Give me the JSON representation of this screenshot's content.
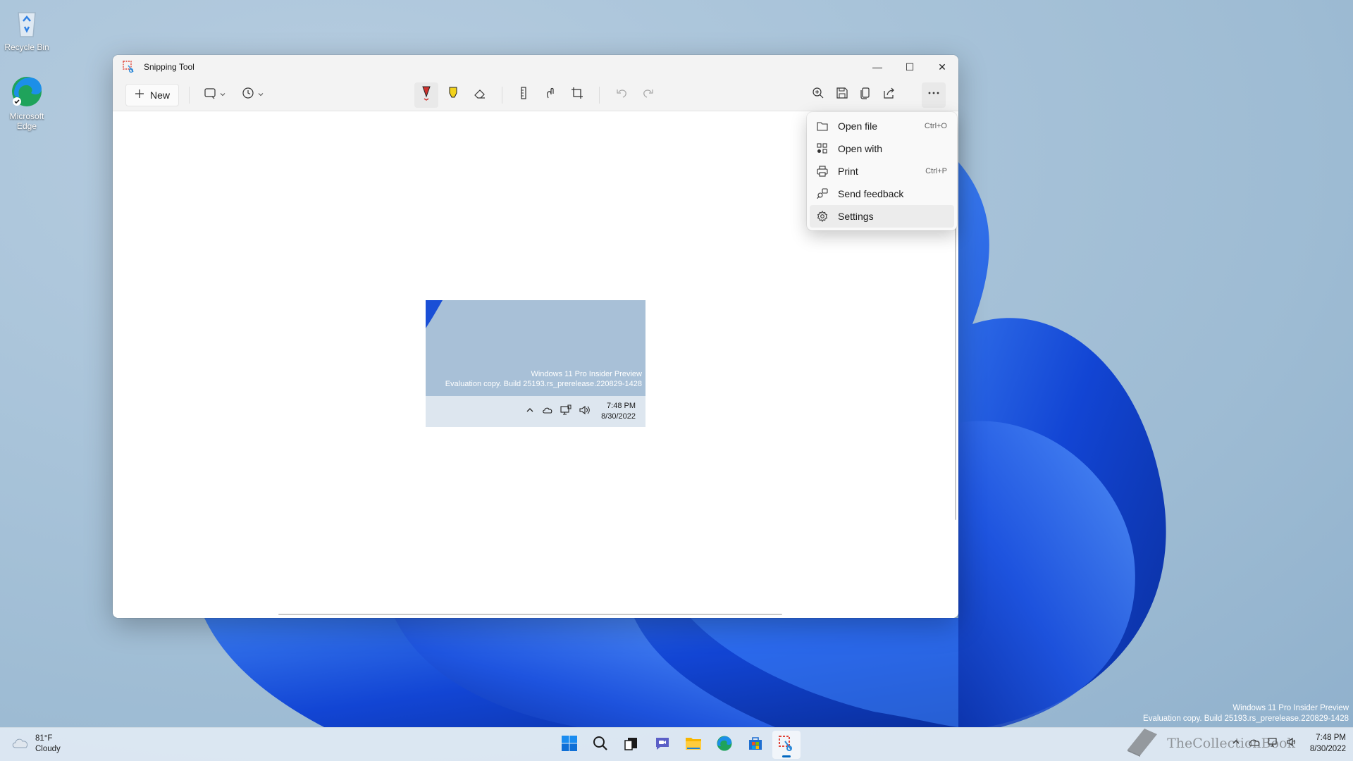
{
  "desktop": {
    "icons": [
      {
        "label": "Recycle Bin"
      },
      {
        "label": "Microsoft Edge"
      }
    ],
    "watermark": {
      "line1": "Windows 11 Pro Insider Preview",
      "line2": "Evaluation copy. Build 25193.rs_prerelease.220829-1428"
    },
    "site_watermark": "TheCollectionBook"
  },
  "window": {
    "title": "Snipping Tool",
    "caption_buttons": {
      "minimize": "—",
      "maximize": "☐",
      "close": "✕"
    },
    "toolbar": {
      "new_label": "New",
      "tools": [
        "snip-mode",
        "delay",
        "ballpoint-pen",
        "highlighter",
        "eraser",
        "ruler",
        "touch-writing",
        "crop",
        "undo",
        "redo",
        "zoom",
        "save",
        "copy",
        "share",
        "more"
      ]
    },
    "preview": {
      "watermark_line1": "Windows 11 Pro Insider Preview",
      "watermark_line2": "Evaluation copy. Build 25193.rs_prerelease.220829-1428",
      "time": "7:48 PM",
      "date": "8/30/2022"
    }
  },
  "menu": {
    "items": [
      {
        "label": "Open file",
        "shortcut": "Ctrl+O",
        "icon": "folder-icon"
      },
      {
        "label": "Open with",
        "shortcut": "",
        "icon": "apps-icon"
      },
      {
        "label": "Print",
        "shortcut": "Ctrl+P",
        "icon": "printer-icon"
      },
      {
        "label": "Send feedback",
        "shortcut": "",
        "icon": "feedback-icon"
      },
      {
        "label": "Settings",
        "shortcut": "",
        "icon": "gear-icon"
      }
    ],
    "highlighted": "Settings"
  },
  "taskbar": {
    "weather": {
      "temp": "81°F",
      "condition": "Cloudy"
    },
    "apps": [
      "start",
      "search",
      "task-view",
      "chat",
      "file-explorer",
      "edge",
      "store",
      "snipping-tool"
    ],
    "active_app": "snipping-tool",
    "clock": {
      "time": "7:48 PM",
      "date": "8/30/2022"
    }
  },
  "colors": {
    "accent": "#0067c0",
    "window_bg": "#ffffff",
    "toolbar_bg": "#f3f3f3",
    "bloom": "#1645d6"
  }
}
